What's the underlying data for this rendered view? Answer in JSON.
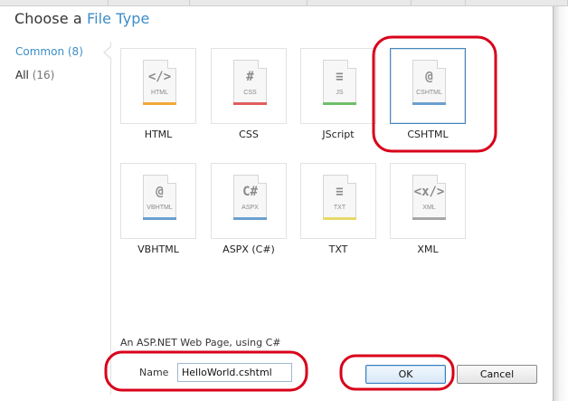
{
  "dialog": {
    "title_prefix": "Choose a",
    "title_accent": "File Type"
  },
  "sidebar": {
    "items": [
      {
        "label": "Common",
        "count": "(8)",
        "active": true
      },
      {
        "label": "All",
        "count": "(16)",
        "active": false
      }
    ]
  },
  "file_types": [
    {
      "label": "HTML",
      "ext": "HTML",
      "glyph": "</>",
      "bar_color": "#f0a93a",
      "icon": "html-file-icon"
    },
    {
      "label": "CSS",
      "ext": "CSS",
      "glyph": "#",
      "bar_color": "#e05d5d",
      "icon": "css-file-icon"
    },
    {
      "label": "JScript",
      "ext": "JS",
      "glyph": "≡",
      "bar_color": "#6fbf6a",
      "icon": "js-file-icon"
    },
    {
      "label": "CSHTML",
      "ext": "CSHTML",
      "glyph": "@",
      "bar_color": "#6b9fcf",
      "icon": "cshtml-file-icon",
      "selected": true
    },
    {
      "label": "VBHTML",
      "ext": "VBHTML",
      "glyph": "@",
      "bar_color": "#6b9fcf",
      "icon": "vbhtml-file-icon"
    },
    {
      "label": "ASPX (C#)",
      "ext": "ASPX",
      "glyph": "C#",
      "bar_color": "#6b9fcf",
      "icon": "aspx-file-icon"
    },
    {
      "label": "TXT",
      "ext": "TXT",
      "glyph": "≡",
      "bar_color": "#e6da6a",
      "icon": "txt-file-icon"
    },
    {
      "label": "XML",
      "ext": "XML",
      "glyph": "<x/>",
      "bar_color": "#a7a7a7",
      "icon": "xml-file-icon"
    }
  ],
  "description": "An ASP.NET Web Page, using C#",
  "name_field": {
    "label": "Name",
    "value": "HelloWorld.cshtml"
  },
  "buttons": {
    "ok": "OK",
    "cancel": "Cancel"
  },
  "colors": {
    "accent": "#3c8ec6",
    "annotation": "#d8001a"
  }
}
